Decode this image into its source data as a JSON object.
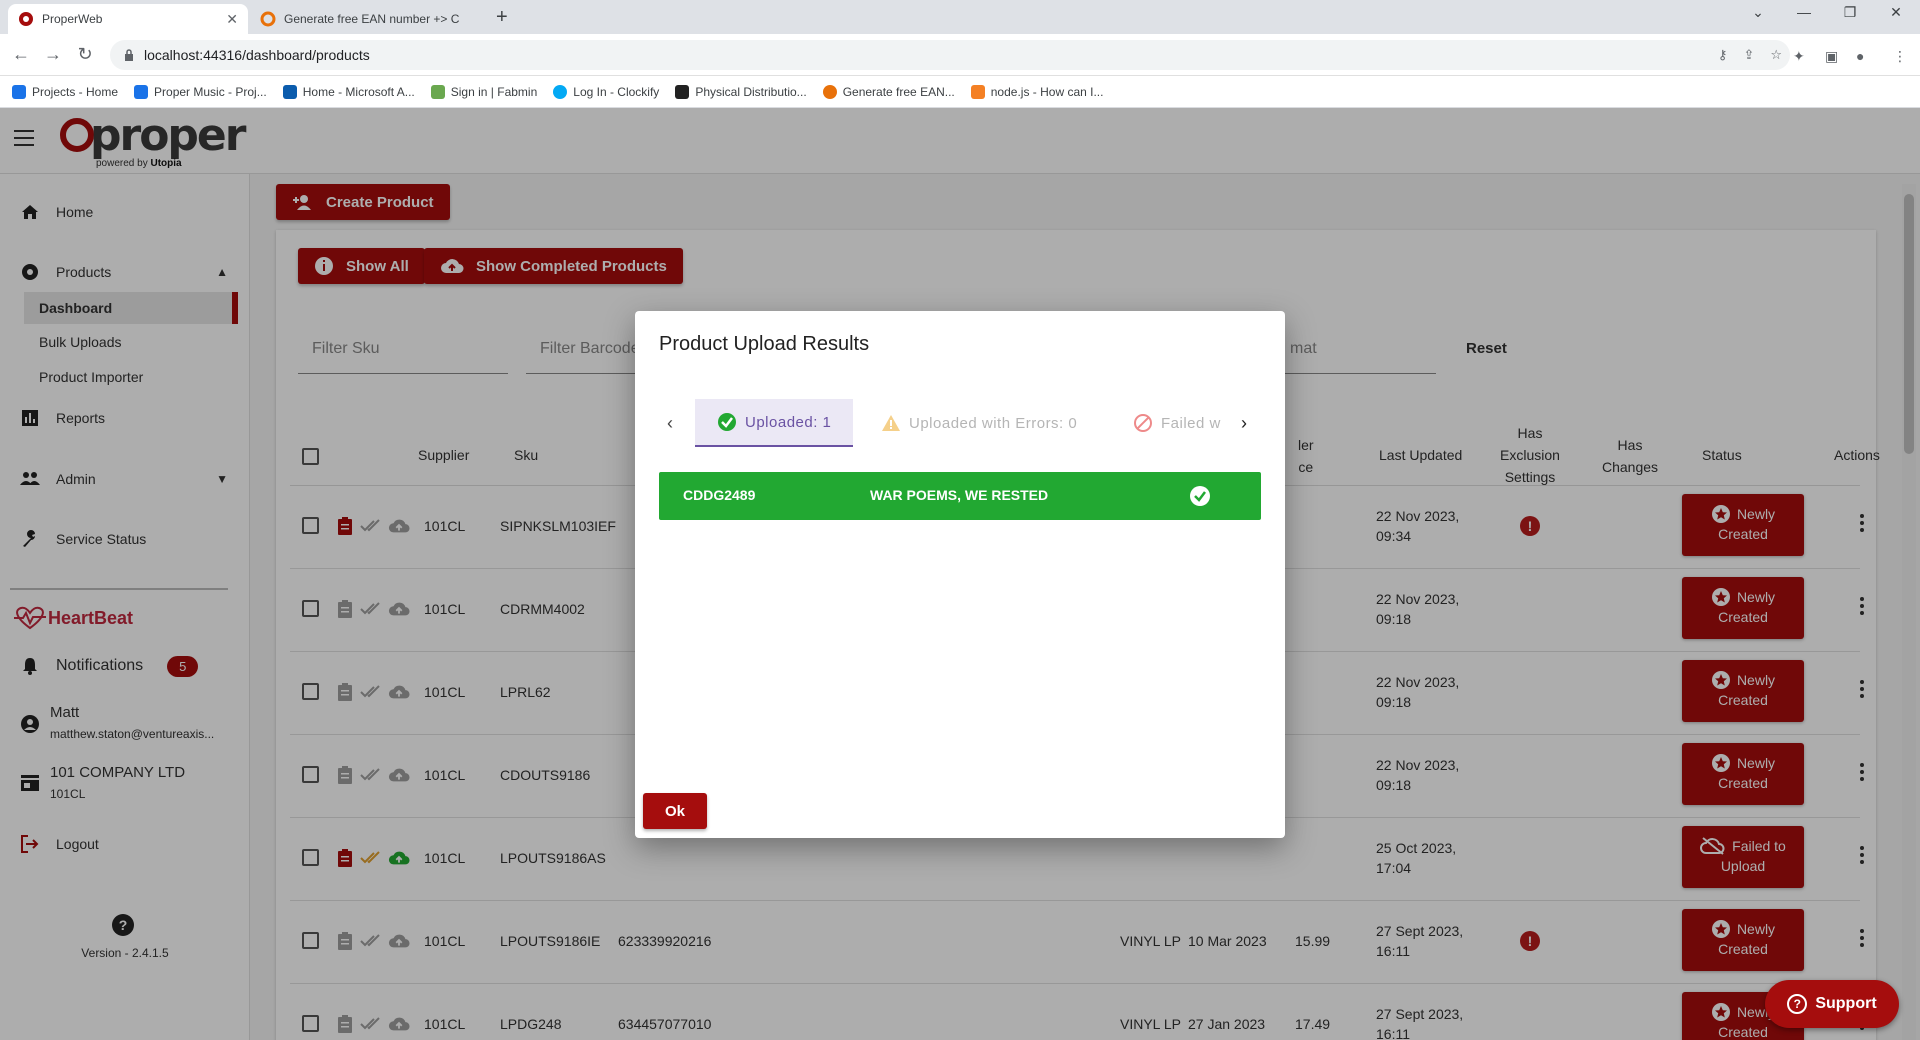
{
  "browser": {
    "tabs": [
      {
        "title": "ProperWeb",
        "close": "✕"
      },
      {
        "title": "Generate free EAN number +> C",
        "close": ""
      }
    ],
    "new_tab": "+",
    "url": "localhost:44316/dashboard/products",
    "bookmarks": [
      {
        "label": "Projects - Home",
        "color": "#1a73e8"
      },
      {
        "label": "Proper Music - Proj...",
        "color": "#1a73e8"
      },
      {
        "label": "Home - Microsoft A...",
        "color": "#0b5cad"
      },
      {
        "label": "Sign in | Fabmin",
        "color": "#6aa84f"
      },
      {
        "label": "Log In - Clockify",
        "color": "#03a9f4"
      },
      {
        "label": "Physical Distributio...",
        "color": "#222222"
      },
      {
        "label": "Generate free EAN...",
        "color": "#e8710a"
      },
      {
        "label": "node.js - How can I...",
        "color": "#f48024"
      }
    ]
  },
  "app": {
    "logo": {
      "word": "proper",
      "sub_prefix": "powered by ",
      "sub_brand": "Utopia"
    },
    "sidebar": {
      "home": "Home",
      "products": "Products",
      "dashboard": "Dashboard",
      "bulk_uploads": "Bulk Uploads",
      "product_importer": "Product Importer",
      "reports": "Reports",
      "admin": "Admin",
      "service_status": "Service Status",
      "heartbeat": "HeartBeat",
      "notifications": "Notifications",
      "notifications_count": "5",
      "user_name": "Matt",
      "user_email": "matthew.staton@ventureaxis...",
      "company_name": "101 COMPANY LTD",
      "company_code": "101CL",
      "logout": "Logout",
      "version": "Version - 2.4.1.5"
    },
    "toolbar": {
      "create_product": "Create Product",
      "show_all": "Show All",
      "show_completed": "Show Completed Products",
      "reset": "Reset"
    },
    "filters": {
      "sku_placeholder": "Filter Sku",
      "barcode_placeholder": "Filter Barcode",
      "format_placeholder": "mat"
    },
    "table": {
      "headers": {
        "supplier": "Supplier",
        "sku": "Sku",
        "dealer_price_a": "ler",
        "dealer_price_b": "ce",
        "last_updated": "Last Updated",
        "has_exclusion_a": "Has",
        "has_exclusion_b": "Exclusion",
        "has_exclusion_c": "Settings",
        "has_changes_a": "Has",
        "has_changes_b": "Changes",
        "status": "Status",
        "actions": "Actions"
      },
      "rows": [
        {
          "supplier": "101CL",
          "sku": "SIPNKSLM103IEF",
          "barcode": "",
          "format": "",
          "release": "",
          "price": "",
          "updated_date": "22 Nov 2023,",
          "updated_time": "09:34",
          "exclusion": true,
          "status_a": "Newly",
          "status_b": "Created",
          "status_icon": "star",
          "active_icons": true
        },
        {
          "supplier": "101CL",
          "sku": "CDRMM4002",
          "barcode": "",
          "format": "",
          "release": "",
          "price": "",
          "updated_date": "22 Nov 2023,",
          "updated_time": "09:18",
          "exclusion": false,
          "status_a": "Newly",
          "status_b": "Created",
          "status_icon": "star",
          "active_icons": false
        },
        {
          "supplier": "101CL",
          "sku": "LPRL62",
          "barcode": "",
          "format": "",
          "release": "",
          "price": "",
          "updated_date": "22 Nov 2023,",
          "updated_time": "09:18",
          "exclusion": false,
          "status_a": "Newly",
          "status_b": "Created",
          "status_icon": "star",
          "active_icons": false
        },
        {
          "supplier": "101CL",
          "sku": "CDOUTS9186",
          "barcode": "",
          "format": "",
          "release": "",
          "price": "",
          "updated_date": "22 Nov 2023,",
          "updated_time": "09:18",
          "exclusion": false,
          "status_a": "Newly",
          "status_b": "Created",
          "status_icon": "star",
          "active_icons": false
        },
        {
          "supplier": "101CL",
          "sku": "LPOUTS9186AS",
          "barcode": "",
          "format": "",
          "release": "",
          "price": "",
          "updated_date": "25 Oct 2023,",
          "updated_time": "17:04",
          "exclusion": false,
          "status_a": "Failed to",
          "status_b": "Upload",
          "status_icon": "cloud-off",
          "active_icons": true
        },
        {
          "supplier": "101CL",
          "sku": "LPOUTS9186IE",
          "barcode": "623339920216",
          "format": "VINYL LP",
          "release": "10 Mar 2023",
          "price": "15.99",
          "updated_date": "27 Sept 2023,",
          "updated_time": "16:11",
          "exclusion": true,
          "status_a": "Newly",
          "status_b": "Created",
          "status_icon": "star",
          "active_icons": false
        },
        {
          "supplier": "101CL",
          "sku": "LPDG248",
          "barcode": "634457077010",
          "format": "VINYL LP",
          "release": "27 Jan 2023",
          "price": "17.49",
          "updated_date": "27 Sept 2023,",
          "updated_time": "16:11",
          "exclusion": false,
          "status_a": "Newly",
          "status_b": "Created",
          "status_icon": "star",
          "active_icons": false
        }
      ]
    },
    "modal": {
      "title": "Product Upload Results",
      "tabs": [
        {
          "label": "Uploaded: 1",
          "state": "active"
        },
        {
          "label": "Uploaded with Errors: 0",
          "state": "disabled"
        },
        {
          "label": "Failed w",
          "state": "disabled"
        }
      ],
      "result": {
        "sku": "CDDG2489",
        "title": "WAR POEMS, WE RESTED"
      },
      "ok": "Ok"
    },
    "support": "Support"
  },
  "colors": {
    "brand_red": "#a50d0d",
    "success_green": "#22a832",
    "tab_purple": "#6a52a3",
    "heartbeat_pink": "#c0283f"
  }
}
